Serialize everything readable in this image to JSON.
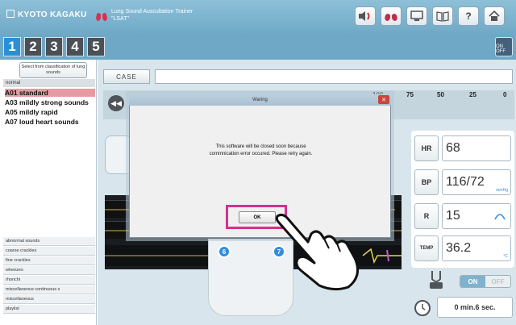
{
  "header": {
    "brand": "KYOTO KAGAKU",
    "product_line1": "Lung Sound Auscultation Trainer",
    "product_line2": "\"LSAT\"",
    "icons": [
      "speaker-lung-icon",
      "lungs-icon",
      "monitor-icon",
      "book-icon",
      "help-icon",
      "home-icon"
    ],
    "help_glyph": "?"
  },
  "tabs": [
    "1",
    "2",
    "3",
    "4",
    "5"
  ],
  "onoff_label": "ON OFF",
  "sidebar": {
    "select_button": "Select from classification of lung sounds",
    "header": "normal",
    "items": [
      "A01 standard",
      "A03 mildly strong sounds",
      "A05 mildly rapid",
      "A07 loud heart sounds"
    ],
    "categories": [
      "abnormal sounds",
      "coarse crackles",
      "fine crackles",
      "wheezes",
      "rhonchi",
      "miscellaneous continuous s",
      "miscellaneous",
      "playlist"
    ]
  },
  "main": {
    "case_label": "CASE",
    "case_value": "",
    "scale": [
      "100",
      "75",
      "50",
      "25",
      "0"
    ]
  },
  "markers": [
    "6",
    "7"
  ],
  "vitals": {
    "hr_label": "HR",
    "hr_value": "68",
    "bp_label": "BP",
    "bp_value": "116/72",
    "bp_unit": "mmHg",
    "r_label": "R",
    "r_value": "15",
    "temp_label": "TEMP",
    "temp_value": "36.2",
    "temp_unit": "°C"
  },
  "toggle": {
    "on": "ON",
    "off": "OFF"
  },
  "timer": "0 min.6 sec.",
  "dialog": {
    "title": "Waring",
    "message_line1": "This software will be closed soon because",
    "message_line2": "commnication error occured. Please retry again.",
    "ok_label": "OK"
  },
  "colors": {
    "header_blue": "#6ea8c6",
    "tab_active": "#2b8fd6",
    "highlight_pink": "#d6308f",
    "selected_item": "#e79aa3"
  }
}
